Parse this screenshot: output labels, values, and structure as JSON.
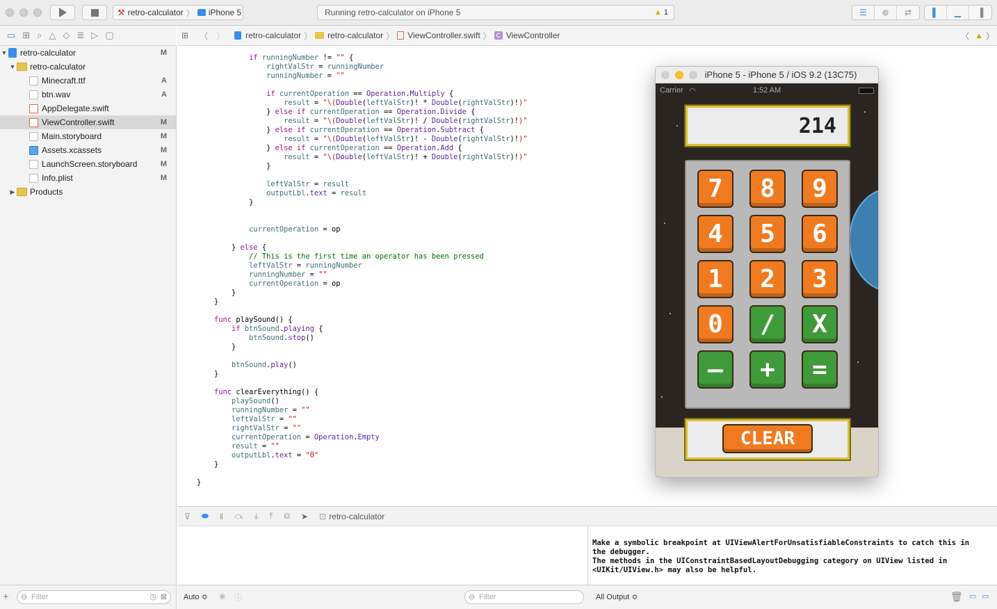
{
  "toolbar": {
    "scheme_project": "retro-calculator",
    "scheme_device": "iPhone 5",
    "status_text": "Running retro-calculator on iPhone 5",
    "warning_count": "1"
  },
  "navigator": {
    "items": [
      {
        "label": "retro-calculator",
        "badge": "M"
      },
      {
        "label": "retro-calculator",
        "badge": ""
      },
      {
        "label": "Minecraft.ttf",
        "badge": "A"
      },
      {
        "label": "btn.wav",
        "badge": "A"
      },
      {
        "label": "AppDelegate.swift",
        "badge": ""
      },
      {
        "label": "ViewController.swift",
        "badge": "M"
      },
      {
        "label": "Main.storyboard",
        "badge": "M"
      },
      {
        "label": "Assets.xcassets",
        "badge": "M"
      },
      {
        "label": "LaunchScreen.storyboard",
        "badge": "M"
      },
      {
        "label": "Info.plist",
        "badge": "M"
      },
      {
        "label": "Products",
        "badge": ""
      }
    ],
    "filter_placeholder": "Filter"
  },
  "jumpbar": {
    "crumbs": [
      "retro-calculator",
      "retro-calculator",
      "ViewController.swift",
      "ViewController"
    ]
  },
  "debug": {
    "target": "retro-calculator",
    "auto_label": "Auto ≎",
    "filter_placeholder": "Filter",
    "output_label": "All Output ≎"
  },
  "console": {
    "text": "Make a symbolic breakpoint at UIViewAlertForUnsatisfiableConstraints to catch this in\nthe debugger.\nThe methods in the UIConstraintBasedLayoutDebugging category on UIView listed in\n<UIKit/UIView.h> may also be helpful."
  },
  "simulator": {
    "title": "iPhone 5 - iPhone 5 / iOS 9.2 (13C75)",
    "carrier": "Carrier",
    "time": "1:52 AM",
    "display_value": "214",
    "keys": [
      "7",
      "8",
      "9",
      "4",
      "5",
      "6",
      "1",
      "2",
      "3",
      "0",
      "/",
      "X",
      "—",
      "+",
      "="
    ],
    "clear_label": "CLEAR"
  }
}
